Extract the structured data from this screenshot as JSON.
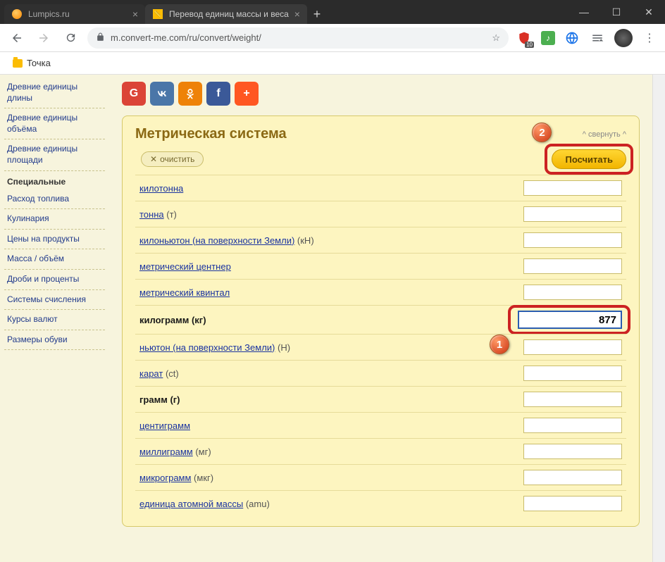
{
  "window": {
    "tabs": [
      {
        "title": "Lumpics.ru",
        "active": false
      },
      {
        "title": "Перевод единиц массы и веса",
        "active": true
      }
    ]
  },
  "toolbar": {
    "url": "m.convert-me.com/ru/convert/weight/"
  },
  "bookmarks": {
    "items": [
      {
        "label": "Точка"
      }
    ]
  },
  "sidebar": {
    "groups": [
      {
        "items": [
          {
            "label": "Древние единицы длины"
          },
          {
            "label": "Древние единицы объёма"
          },
          {
            "label": "Древние единицы площади"
          }
        ]
      },
      {
        "heading": "Специальные",
        "items": [
          {
            "label": "Расход топлива"
          },
          {
            "label": "Кулинария"
          },
          {
            "label": "Цены на продукты"
          },
          {
            "label": "Масса / объём"
          },
          {
            "label": "Дроби и проценты"
          },
          {
            "label": "Системы счисления"
          },
          {
            "label": "Курсы валют"
          },
          {
            "label": "Размеры обуви"
          }
        ]
      }
    ]
  },
  "panel": {
    "title": "Метрическая система",
    "collapse": "^ свернуть ^",
    "clear": "очистить",
    "calc": "Посчитать",
    "units": [
      {
        "name": "килотонна",
        "suffix": "",
        "bold": false,
        "value": ""
      },
      {
        "name": "тонна",
        "suffix": " (т)",
        "bold": false,
        "value": ""
      },
      {
        "name": "килоньютон (на поверхности Земли)",
        "suffix": " (кН)",
        "bold": false,
        "value": ""
      },
      {
        "name": "метрический центнер",
        "suffix": "",
        "bold": false,
        "value": ""
      },
      {
        "name": "метрический квинтал",
        "suffix": "",
        "bold": false,
        "value": ""
      },
      {
        "name": "килограмм",
        "suffix": " (кг)",
        "bold": true,
        "value": "877"
      },
      {
        "name": "ньютон (на поверхности Земли)",
        "suffix": " (Н)",
        "bold": false,
        "value": ""
      },
      {
        "name": "карат",
        "suffix": " (ct)",
        "bold": false,
        "value": ""
      },
      {
        "name": "грамм",
        "suffix": " (г)",
        "bold": true,
        "value": ""
      },
      {
        "name": "центиграмм",
        "suffix": "",
        "bold": false,
        "value": ""
      },
      {
        "name": "миллиграмм",
        "suffix": " (мг)",
        "bold": false,
        "value": ""
      },
      {
        "name": "микрограмм",
        "suffix": " (мкг)",
        "bold": false,
        "value": ""
      },
      {
        "name": "единица атомной массы",
        "suffix": " (amu)",
        "bold": false,
        "value": ""
      }
    ]
  },
  "callouts": {
    "one": "1",
    "two": "2"
  },
  "share": {
    "g": "G",
    "vk": "K",
    "ok": "o",
    "fb": "f",
    "plus": "+"
  }
}
